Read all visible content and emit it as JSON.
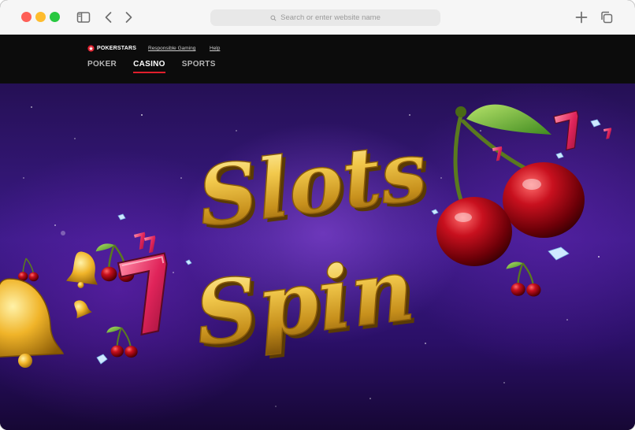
{
  "browser": {
    "address_placeholder": "Search or enter website name",
    "icons": [
      "sidebar-icon",
      "back-icon",
      "forward-icon",
      "search-icon",
      "new-tab-icon",
      "tabs-overview-icon"
    ]
  },
  "site": {
    "brand": "POKERSTARS",
    "top_links": [
      "Responsible Gaming",
      "Help"
    ],
    "nav": [
      {
        "label": "POKER",
        "active": false
      },
      {
        "label": "CASINO",
        "active": true
      },
      {
        "label": "SPORTS",
        "active": false
      }
    ],
    "accent_color": "#e01e2c"
  },
  "hero": {
    "logo_word_1": "Slots",
    "logo_word_2": "Spin",
    "decor": [
      "cherry",
      "lucky-seven",
      "bell",
      "diamond"
    ]
  }
}
